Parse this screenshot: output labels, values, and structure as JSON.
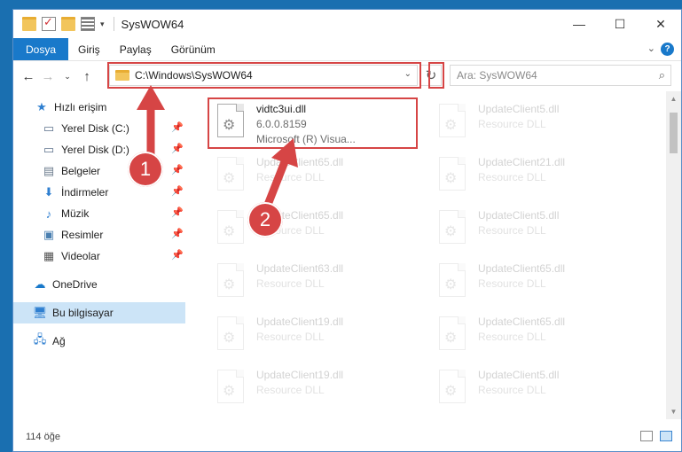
{
  "window": {
    "title": "SysWOW64"
  },
  "ribbon": {
    "tabs": [
      "Dosya",
      "Giriş",
      "Paylaş",
      "Görünüm"
    ]
  },
  "address": {
    "path": "C:\\Windows\\SysWOW64"
  },
  "search": {
    "placeholder": "Ara: SysWOW64"
  },
  "sidebar": {
    "items": [
      {
        "label": "Hızlı erişim",
        "icon": "star-icon"
      },
      {
        "label": "Yerel Disk (C:)",
        "icon": "drive-icon"
      },
      {
        "label": "Yerel Disk (D:)",
        "icon": "drive-icon"
      },
      {
        "label": "Belgeler",
        "icon": "documents-icon"
      },
      {
        "label": "İndirmeler",
        "icon": "download-icon"
      },
      {
        "label": "Müzik",
        "icon": "music-icon"
      },
      {
        "label": "Resimler",
        "icon": "pictures-icon"
      },
      {
        "label": "Videolar",
        "icon": "videos-icon"
      },
      {
        "label": "OneDrive",
        "icon": "cloud-icon"
      },
      {
        "label": "Bu bilgisayar",
        "icon": "computer-icon"
      },
      {
        "label": "Ağ",
        "icon": "network-icon"
      }
    ]
  },
  "files": [
    {
      "name": "vidtc3ui.dll",
      "line2": "6.0.0.8159",
      "line3": "Microsoft (R) Visua..."
    },
    {
      "name": "UpdateClient5.dll",
      "line2": "Resource DLL"
    },
    {
      "name": "UpdateClient65.dll",
      "line2": "Resource DLL"
    },
    {
      "name": "UpdateClient21.dll",
      "line2": "Resource DLL"
    },
    {
      "name": "UpdateClient65.dll",
      "line2": "Resource DLL"
    },
    {
      "name": "UpdateClient5.dll",
      "line2": "Resource DLL"
    },
    {
      "name": "UpdateClient63.dll",
      "line2": "Resource DLL"
    },
    {
      "name": "UpdateClient65.dll",
      "line2": "Resource DLL"
    },
    {
      "name": "UpdateClient19.dll",
      "line2": "Resource DLL"
    },
    {
      "name": "UpdateClient65.dll",
      "line2": "Resource DLL"
    },
    {
      "name": "UpdateClient19.dll",
      "line2": "Resource DLL"
    },
    {
      "name": "UpdateClient5.dll",
      "line2": "Resource DLL"
    }
  ],
  "status": {
    "count": "114 öğe"
  },
  "annotations": {
    "step1": "1",
    "step2": "2"
  },
  "colors": {
    "accent": "#1979ca",
    "annotation": "#d64545"
  }
}
